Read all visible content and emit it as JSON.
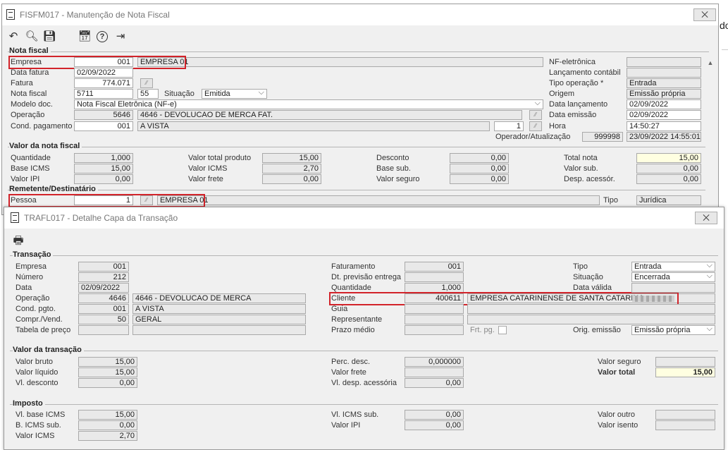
{
  "background": {
    "peek_text": "do"
  },
  "win1": {
    "title": "FISFM017 - Manutenção de Nota Fiscal",
    "close": "⨉",
    "toolbar": {
      "undo": "↶",
      "search": "🔍︎",
      "save": "💾︎",
      "calendar": "📅︎",
      "help": "?",
      "exit": "⇥"
    },
    "nota_fiscal": {
      "section": "Nota fiscal",
      "empresa_label": "Empresa",
      "empresa_code": "001",
      "empresa_name": "EMPRESA 01",
      "data_fatura_label": "Data fatura",
      "data_fatura": "02/09/2022",
      "fatura_label": "Fatura",
      "fatura": "774.071",
      "nota_fiscal_label": "Nota fiscal",
      "nota_fiscal": "5711",
      "serie": "55",
      "situacao_label": "Situação",
      "situacao": "Emitida",
      "modelo_label": "Modelo doc.",
      "modelo": "Nota Fiscal Eletrônica (NF-e)",
      "operacao_label": "Operação",
      "operacao_code": "5646",
      "operacao_desc": "4646 - DEVOLUCAO DE MERCA FAT.",
      "cond_label": "Cond. pagamento",
      "cond_code": "001",
      "cond_desc": "A VISTA",
      "cond_parcelas": "1",
      "nfe_label": "NF-eletrônica",
      "nfe": "",
      "lanc_contabil_label": "Lançamento contábil",
      "lanc_contabil": "",
      "tipo_op_label": "Tipo operação *",
      "tipo_op": "Entrada",
      "origem_label": "Origem",
      "origem": "Emissão própria",
      "data_lanc_label": "Data lançamento",
      "data_lanc": "02/09/2022",
      "data_emissao_label": "Data emissão",
      "data_emissao": "02/09/2022",
      "hora_label": "Hora",
      "hora": "14:50:27",
      "operador_label": "Operador/Atualização",
      "operador": "999998",
      "atualizacao": "23/09/2022 14:55:01"
    },
    "valor": {
      "section": "Valor da nota fiscal",
      "quantidade_label": "Quantidade",
      "quantidade": "1,000",
      "base_icms_label": "Base ICMS",
      "base_icms": "15,00",
      "valor_ipi_label": "Valor IPI",
      "valor_ipi": "0,00",
      "vtp_label": "Valor total produto",
      "vtp": "15,00",
      "valor_icms_label": "Valor ICMS",
      "valor_icms": "2,70",
      "valor_frete_label": "Valor frete",
      "valor_frete": "0,00",
      "desconto_label": "Desconto",
      "desconto": "0,00",
      "base_sub_label": "Base sub.",
      "base_sub": "0,00",
      "valor_seguro_label": "Valor seguro",
      "valor_seguro": "0,00",
      "total_nota_label": "Total nota",
      "total_nota": "15,00",
      "valor_sub_label": "Valor sub.",
      "valor_sub": "0,00",
      "desp_label": "Desp. acessór.",
      "desp": "0,00"
    },
    "remetente": {
      "section": "Remetente/Destinatário",
      "pessoa_label": "Pessoa",
      "pessoa_code": "1",
      "pessoa_name": "EMPRESA 01",
      "tipo_label": "Tipo",
      "tipo": "Jurídica"
    }
  },
  "win2": {
    "title": "TRAFL017 - Detalhe Capa da Transação",
    "close": "⨉",
    "print_icon": "🖶︎",
    "transacao": {
      "section": "Transação",
      "empresa_label": "Empresa",
      "empresa": "001",
      "numero_label": "Número",
      "numero": "212",
      "data_label": "Data",
      "data": "02/09/2022",
      "operacao_label": "Operação",
      "operacao_code": "4646",
      "operacao_desc": "4646 - DEVOLUCAO DE MERCA",
      "cond_label": "Cond. pgto.",
      "cond_code": "001",
      "cond_desc": "A VISTA",
      "compr_label": "Compr./Vend.",
      "compr_code": "50",
      "compr_desc": "GERAL",
      "tabela_label": "Tabela de preço",
      "tabela": "",
      "faturamento_label": "Faturamento",
      "faturamento": "001",
      "dt_prev_label": "Dt. previsão entrega",
      "dt_prev": "",
      "quantidade_label": "Quantidade",
      "quantidade": "1,000",
      "cliente_label": "Cliente",
      "cliente_code": "400611",
      "cliente_name": "EMPRESA CATARINENSE DE SANTA CATARINA",
      "guia_label": "Guia",
      "guia": "",
      "representante_label": "Representante",
      "representante": "",
      "prazo_label": "Prazo médio",
      "prazo": "",
      "frt_label": "Frt. pg.",
      "tipo_label": "Tipo",
      "tipo": "Entrada",
      "situacao_label": "Situação",
      "situacao": "Encerrada",
      "data_valida_label": "Data válida",
      "data_valida": "",
      "orig_label": "Orig. emissão",
      "orig": "Emissão própria"
    },
    "valor": {
      "section": "Valor da transação",
      "bruto_label": "Valor bruto",
      "bruto": "15,00",
      "liquido_label": "Valor líquido",
      "liquido": "15,00",
      "desconto_label": "Vl. desconto",
      "desconto": "0,00",
      "perc_label": "Perc. desc.",
      "perc": "0,000000",
      "frete_label": "Valor frete",
      "frete": "",
      "desp_label": "Vl. desp. acessória",
      "desp": "0,00",
      "seguro_label": "Valor seguro",
      "seguro": "",
      "total_label": "Valor total",
      "total": "15,00"
    },
    "imposto": {
      "section": "Imposto",
      "base_icms_label": "Vl. base ICMS",
      "base_icms": "15,00",
      "bicms_sub_label": "B. ICMS sub.",
      "bicms_sub": "0,00",
      "valor_icms_label": "Valor ICMS",
      "valor_icms": "2,70",
      "icms_sub_label": "Vl. ICMS sub.",
      "icms_sub": "0,00",
      "ipi_label": "Valor IPI",
      "ipi": "0,00",
      "outro_label": "Valor outro",
      "outro": "",
      "isento_label": "Valor isento",
      "isento": ""
    }
  }
}
